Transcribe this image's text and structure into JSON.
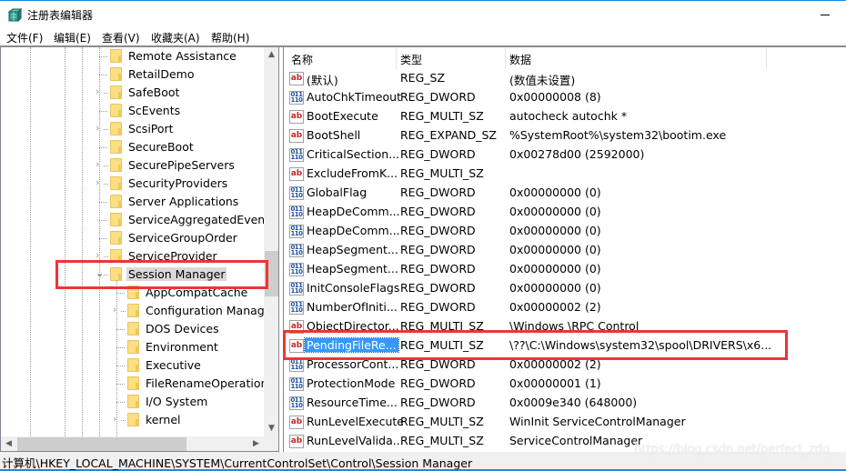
{
  "window": {
    "title": "注册表编辑器",
    "app_icon": "regedit-icon",
    "minimize_icon": "minimize-icon"
  },
  "menu": [
    "文件(F)",
    "编辑(E)",
    "查看(V)",
    "收藏夹(A)",
    "帮助(H)"
  ],
  "tree": {
    "items": [
      {
        "label": "Remote Assistance",
        "level": 0,
        "expander": "none"
      },
      {
        "label": "RetailDemo",
        "level": 0,
        "expander": "none"
      },
      {
        "label": "SafeBoot",
        "level": 0,
        "expander": "collapsed"
      },
      {
        "label": "ScEvents",
        "level": 0,
        "expander": "none"
      },
      {
        "label": "ScsiPort",
        "level": 0,
        "expander": "collapsed"
      },
      {
        "label": "SecureBoot",
        "level": 0,
        "expander": "none"
      },
      {
        "label": "SecurePipeServers",
        "level": 0,
        "expander": "collapsed"
      },
      {
        "label": "SecurityProviders",
        "level": 0,
        "expander": "collapsed"
      },
      {
        "label": "Server Applications",
        "level": 0,
        "expander": "none"
      },
      {
        "label": "ServiceAggregatedEvents",
        "level": 0,
        "expander": "none"
      },
      {
        "label": "ServiceGroupOrder",
        "level": 0,
        "expander": "none"
      },
      {
        "label": "ServiceProvider",
        "level": 0,
        "expander": "collapsed"
      },
      {
        "label": "Session Manager",
        "level": 0,
        "expander": "expanded",
        "selected": true
      },
      {
        "label": "AppCompatCache",
        "level": 1,
        "expander": "none"
      },
      {
        "label": "Configuration Manager",
        "level": 1,
        "expander": "collapsed"
      },
      {
        "label": "DOS Devices",
        "level": 1,
        "expander": "none"
      },
      {
        "label": "Environment",
        "level": 1,
        "expander": "none"
      },
      {
        "label": "Executive",
        "level": 1,
        "expander": "none"
      },
      {
        "label": "FileRenameOperations",
        "level": 1,
        "expander": "none"
      },
      {
        "label": "I/O System",
        "level": 1,
        "expander": "none"
      },
      {
        "label": "kernel",
        "level": 1,
        "expander": "collapsed"
      }
    ]
  },
  "list": {
    "columns": [
      "名称",
      "类型",
      "数据"
    ],
    "rows": [
      {
        "icon": "string-value-icon",
        "name": "(默认)",
        "type": "REG_SZ",
        "data": "(数值未设置)"
      },
      {
        "icon": "binary-value-icon",
        "name": "AutoChkTimeout",
        "type": "REG_DWORD",
        "data": "0x00000008 (8)"
      },
      {
        "icon": "string-value-icon",
        "name": "BootExecute",
        "type": "REG_MULTI_SZ",
        "data": "autocheck autochk *"
      },
      {
        "icon": "string-value-icon",
        "name": "BootShell",
        "type": "REG_EXPAND_SZ",
        "data": "%SystemRoot%\\system32\\bootim.exe"
      },
      {
        "icon": "binary-value-icon",
        "name": "CriticalSection...",
        "type": "REG_DWORD",
        "data": "0x00278d00 (2592000)"
      },
      {
        "icon": "string-value-icon",
        "name": "ExcludeFromK...",
        "type": "REG_MULTI_SZ",
        "data": ""
      },
      {
        "icon": "binary-value-icon",
        "name": "GlobalFlag",
        "type": "REG_DWORD",
        "data": "0x00000000 (0)"
      },
      {
        "icon": "binary-value-icon",
        "name": "HeapDeComm...",
        "type": "REG_DWORD",
        "data": "0x00000000 (0)"
      },
      {
        "icon": "binary-value-icon",
        "name": "HeapDeComm...",
        "type": "REG_DWORD",
        "data": "0x00000000 (0)"
      },
      {
        "icon": "binary-value-icon",
        "name": "HeapSegment...",
        "type": "REG_DWORD",
        "data": "0x00000000 (0)"
      },
      {
        "icon": "binary-value-icon",
        "name": "HeapSegment...",
        "type": "REG_DWORD",
        "data": "0x00000000 (0)"
      },
      {
        "icon": "binary-value-icon",
        "name": "InitConsoleFlags",
        "type": "REG_DWORD",
        "data": "0x00000000 (0)"
      },
      {
        "icon": "binary-value-icon",
        "name": "NumberOfIniti...",
        "type": "REG_DWORD",
        "data": "0x00000002 (2)"
      },
      {
        "icon": "string-value-icon",
        "name": "ObjectDirector...",
        "type": "REG_MULTI_SZ",
        "data": "\\Windows \\RPC Control"
      },
      {
        "icon": "string-value-icon",
        "name": "PendingFileRe...",
        "type": "REG_MULTI_SZ",
        "data": "\\??\\C:\\Windows\\system32\\spool\\DRIVERS\\x6...",
        "selected": true
      },
      {
        "icon": "binary-value-icon",
        "name": "ProcessorCont...",
        "type": "REG_DWORD",
        "data": "0x00000002 (2)"
      },
      {
        "icon": "binary-value-icon",
        "name": "ProtectionMode",
        "type": "REG_DWORD",
        "data": "0x00000001 (1)"
      },
      {
        "icon": "binary-value-icon",
        "name": "ResourceTime...",
        "type": "REG_DWORD",
        "data": "0x0009e340 (648000)"
      },
      {
        "icon": "string-value-icon",
        "name": "RunLevelExecute",
        "type": "REG_MULTI_SZ",
        "data": "WinInit ServiceControlManager"
      },
      {
        "icon": "string-value-icon",
        "name": "RunLevelValida...",
        "type": "REG_MULTI_SZ",
        "data": "ServiceControlManager"
      }
    ]
  },
  "icons": {
    "string": "ab",
    "binary": "011\n110",
    "chevron_right": "›",
    "chevron_down": "⌄",
    "scroll_up": "▲",
    "scroll_down": "▼",
    "scroll_left": "◀",
    "scroll_right": "▶"
  },
  "statusbar": {
    "path": "计算机\\HKEY_LOCAL_MACHINE\\SYSTEM\\CurrentControlSet\\Control\\Session Manager"
  },
  "watermark": "https://blog.csdn.net/perfect_zdq",
  "colors": {
    "selection": "#3399ff",
    "tree_selection": "#d9d9d9",
    "annotation": "#ee3535",
    "accent": "#1e88e5"
  }
}
